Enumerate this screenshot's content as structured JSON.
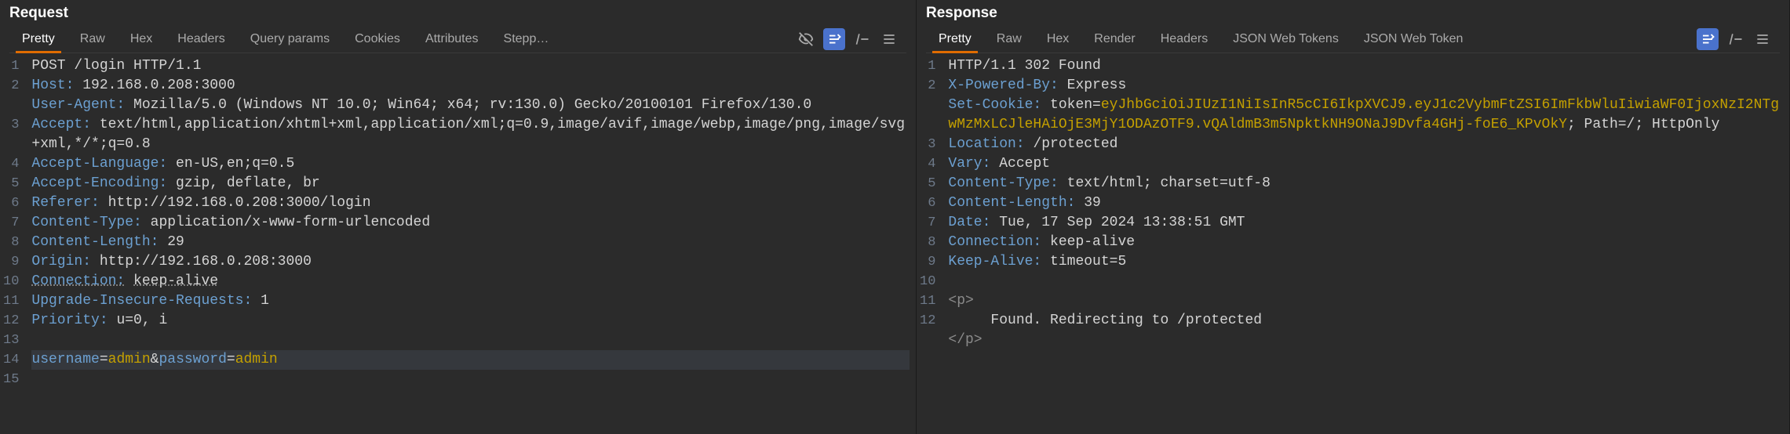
{
  "request": {
    "title": "Request",
    "tabs": [
      "Pretty",
      "Raw",
      "Hex",
      "Headers",
      "Query params",
      "Cookies",
      "Attributes",
      "Stepp…"
    ],
    "activeTab": 0,
    "lines": [
      {
        "n": 1,
        "type": "first",
        "method": "POST",
        "path": "/login",
        "proto": "HTTP/1.1"
      },
      {
        "n": 2,
        "type": "hdr",
        "name": "Host",
        "val": "192.168.0.208:3000"
      },
      {
        "n": 3,
        "type": "hdr-wrap",
        "name": "User-Agent",
        "val": "Mozilla/5.0 (Windows NT 10.0; Win64; x64; rv:130.0) Gecko/20100101 Firefox/130.0"
      },
      {
        "n": 4,
        "type": "hdr-wrap",
        "name": "Accept",
        "val": "text/html,application/xhtml+xml,application/xml;q=0.9,image/avif,image/webp,image/png,image/svg+xml,*/*;q=0.8"
      },
      {
        "n": 5,
        "type": "hdr",
        "name": "Accept-Language",
        "val": "en-US,en;q=0.5"
      },
      {
        "n": 6,
        "type": "hdr",
        "name": "Accept-Encoding",
        "val": "gzip, deflate, br"
      },
      {
        "n": 7,
        "type": "hdr",
        "name": "Referer",
        "val": "http://192.168.0.208:3000/login"
      },
      {
        "n": 8,
        "type": "hdr",
        "name": "Content-Type",
        "val": "application/x-www-form-urlencoded"
      },
      {
        "n": 9,
        "type": "hdr",
        "name": "Content-Length",
        "val": "29"
      },
      {
        "n": 10,
        "type": "hdr",
        "name": "Origin",
        "val": "http://192.168.0.208:3000"
      },
      {
        "n": 11,
        "type": "hdr-conn",
        "name": "Connection",
        "val": "keep-alive"
      },
      {
        "n": 12,
        "type": "hdr",
        "name": "Upgrade-Insecure-Requests",
        "val": "1"
      },
      {
        "n": 13,
        "type": "hdr",
        "name": "Priority",
        "val": "u=0, i"
      },
      {
        "n": 14,
        "type": "blank"
      },
      {
        "n": 15,
        "type": "body",
        "params": [
          {
            "k": "username",
            "v": "admin"
          },
          {
            "k": "password",
            "v": "admin"
          }
        ]
      }
    ]
  },
  "response": {
    "title": "Response",
    "tabs": [
      "Pretty",
      "Raw",
      "Hex",
      "Render",
      "Headers",
      "JSON Web Tokens",
      "JSON Web Token"
    ],
    "activeTab": 0,
    "lines": [
      {
        "n": 1,
        "type": "first-resp",
        "proto": "HTTP/1.1",
        "status": "302 Found"
      },
      {
        "n": 2,
        "type": "hdr",
        "name": "X-Powered-By",
        "val": "Express"
      },
      {
        "n": 3,
        "type": "hdr-cookie",
        "name": "Set-Cookie",
        "prefix": "token=",
        "token": "eyJhbGciOiJIUzI1NiIsInR5cCI6IkpXVCJ9.eyJ1c2VybmFtZSI6ImFkbWluIiwiaWF0IjoxNzI2NTgwMzMxLCJleHAiOjE3MjY1ODAzOTF9.vQAldmB3m5NpktkNH9ONaJ9Dvfa4GHj-foE6_KPvOkY",
        "suffix": "; Path=/; HttpOnly"
      },
      {
        "n": 4,
        "type": "hdr",
        "name": "Location",
        "val": "/protected"
      },
      {
        "n": 5,
        "type": "hdr",
        "name": "Vary",
        "val": "Accept"
      },
      {
        "n": 6,
        "type": "hdr",
        "name": "Content-Type",
        "val": "text/html; charset=utf-8"
      },
      {
        "n": 7,
        "type": "hdr",
        "name": "Content-Length",
        "val": "39"
      },
      {
        "n": 8,
        "type": "hdr",
        "name": "Date",
        "val": "Tue, 17 Sep 2024 13:38:51 GMT"
      },
      {
        "n": 9,
        "type": "hdr",
        "name": "Connection",
        "val": "keep-alive"
      },
      {
        "n": 10,
        "type": "hdr",
        "name": "Keep-Alive",
        "val": "timeout=5"
      },
      {
        "n": 11,
        "type": "blank"
      },
      {
        "n": 12,
        "type": "html-open",
        "tag": "p"
      },
      {
        "n": "",
        "type": "html-text",
        "text": "Found. Redirecting to /protected"
      },
      {
        "n": "",
        "type": "html-close",
        "tag": "p"
      }
    ]
  },
  "icons": {
    "eye_off": "eye-off-icon",
    "render": "render-icon",
    "newline": "newline-icon",
    "menu": "menu-icon"
  }
}
